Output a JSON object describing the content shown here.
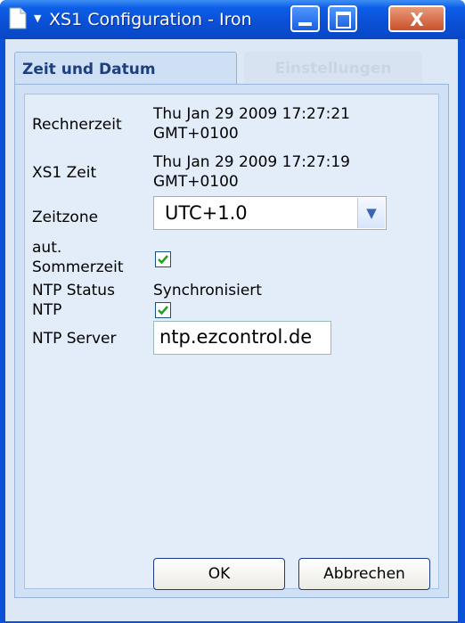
{
  "window": {
    "title": "XS1 Configuration - Iron"
  },
  "tabs": [
    {
      "label": "Zeit und Datum",
      "active": true
    },
    {
      "label": "Einstellungen",
      "active": false
    }
  ],
  "form": {
    "rechnerzeit_label": "Rechnerzeit",
    "rechnerzeit_value_1": "Thu Jan 29 2009 17:27:21",
    "rechnerzeit_value_2": "GMT+0100",
    "xs1zeit_label": "XS1 Zeit",
    "xs1zeit_value_1": "Thu Jan 29 2009 17:27:19",
    "xs1zeit_value_2": "GMT+0100",
    "zeitzone_label": "Zeitzone",
    "zeitzone_value": "UTC+1.0",
    "sommerzeit_label_1": "aut.",
    "sommerzeit_label_2": "Sommerzeit",
    "sommerzeit_checked": true,
    "ntp_status_label": "NTP Status",
    "ntp_status_value": "Synchronisiert",
    "ntp_label": "NTP",
    "ntp_checked": true,
    "ntp_server_label": "NTP Server",
    "ntp_server_value": "ntp.ezcontrol.de"
  },
  "buttons": {
    "ok": "OK",
    "cancel": "Abbrechen"
  }
}
